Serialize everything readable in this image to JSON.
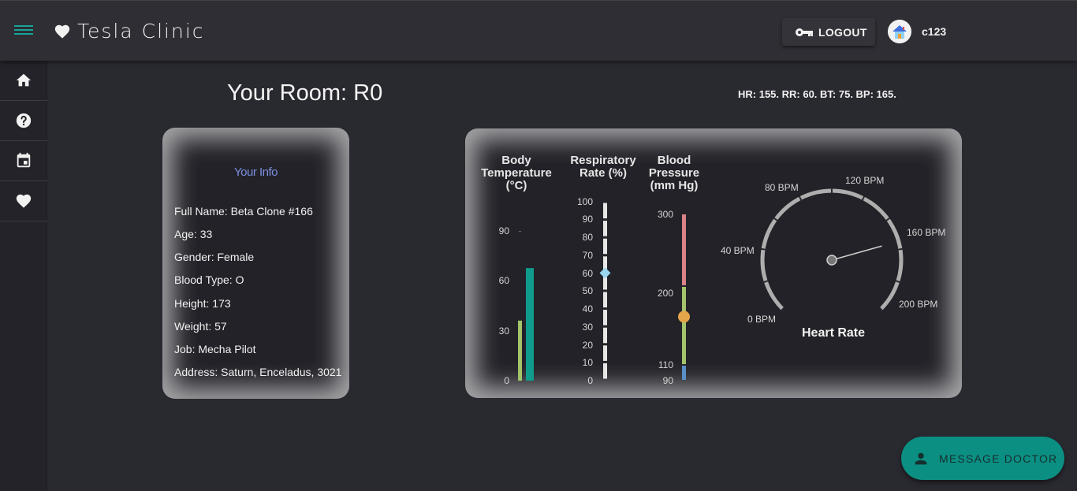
{
  "header": {
    "title": "Tesla Clinic",
    "logout_label": "LOGOUT",
    "username": "c123"
  },
  "sidebar": {
    "items": [
      {
        "icon": "home-icon"
      },
      {
        "icon": "help-icon"
      },
      {
        "icon": "calendar-icon"
      },
      {
        "icon": "heart-icon"
      }
    ]
  },
  "room": {
    "title": "Your Room: R0",
    "vitals_summary": "HR: 155. RR: 60. BT: 75. BP: 165."
  },
  "info": {
    "heading": "Your Info",
    "lines": [
      "Full Name: Beta Clone #166",
      "Age: 33",
      "Gender: Female",
      "Blood Type: O",
      "Height: 173",
      "Weight: 57",
      "Job: Mecha Pilot",
      "Address: Saturn, Enceladus, 3021"
    ]
  },
  "vitals": {
    "body_temp": {
      "title": [
        "Body",
        "Temperature",
        "(°C)"
      ],
      "ticks": [
        "90",
        "60",
        "30",
        "0"
      ],
      "range": [
        0,
        105
      ],
      "value": 75,
      "secondary_value": 40,
      "color": "#0f9c8d",
      "secondary_color": "#a3c46b"
    },
    "respiratory": {
      "title": [
        "Respiratory",
        "Rate (%)"
      ],
      "ticks": [
        "100",
        "90",
        "80",
        "70",
        "60",
        "50",
        "40",
        "30",
        "20",
        "10",
        "0"
      ],
      "range": [
        0,
        100
      ],
      "value": 60,
      "marker_color": "#9ad6f0"
    },
    "blood_pressure": {
      "title": [
        "Blood",
        "Pressure",
        "(mm Hg)"
      ],
      "ticks": [
        "300",
        "200",
        "110",
        "90"
      ],
      "value": 165,
      "segments": [
        {
          "from": 90,
          "to": 110,
          "color": "#5b8fc7"
        },
        {
          "from": 110,
          "to": 200,
          "color": "#a3c46b"
        },
        {
          "from": 200,
          "to": 300,
          "color": "#d98389"
        }
      ],
      "marker_color": "#e3a54a"
    },
    "heart_rate": {
      "title": "Heart Rate",
      "labels": [
        "0 BPM",
        "40 BPM",
        "80 BPM",
        "120 BPM",
        "160 BPM",
        "200 BPM"
      ],
      "range": [
        0,
        200
      ],
      "value": 155
    }
  },
  "fab": {
    "label": "MESSAGE DOCTOR"
  },
  "colors": {
    "accent": "#0b8f83",
    "background": "#292930",
    "heading_blue": "#7b8ee0"
  }
}
